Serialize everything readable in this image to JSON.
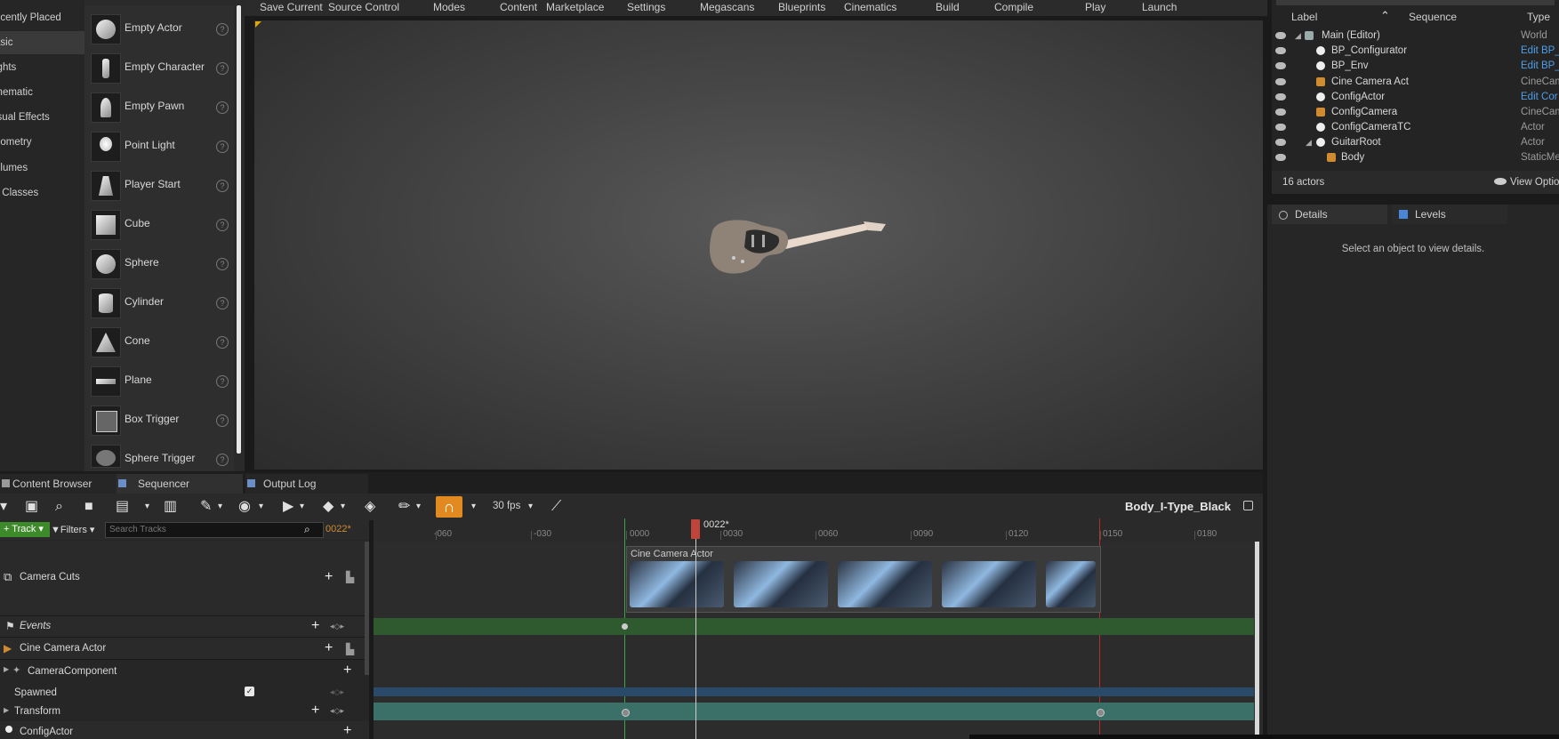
{
  "toolbar": {
    "items": [
      "Save Current",
      "Source Control",
      "Modes",
      "Content",
      "Marketplace",
      "Settings",
      "Megascans",
      "Blueprints",
      "Cinematics",
      "Build",
      "Compile",
      "Play",
      "Launch"
    ]
  },
  "place": {
    "categories": [
      "ecently Placed",
      "asic",
      "ights",
      "inematic",
      "isual Effects",
      "eometry",
      "olumes",
      "ll Classes"
    ],
    "items": [
      "Empty Actor",
      "Empty Character",
      "Empty Pawn",
      "Point Light",
      "Player Start",
      "Cube",
      "Sphere",
      "Cylinder",
      "Cone",
      "Plane",
      "Box Trigger",
      "Sphere Trigger"
    ]
  },
  "outliner": {
    "headers": {
      "label": "Label",
      "sequence": "Sequence",
      "type": "Type"
    },
    "rows": [
      {
        "name": "Main (Editor)",
        "type": "World",
        "link": false
      },
      {
        "name": "BP_Configurator",
        "type": "Edit BP_",
        "link": true
      },
      {
        "name": "BP_Env",
        "type": "Edit BP_",
        "link": true
      },
      {
        "name": "Cine Camera Act",
        "type": "CineCam",
        "link": false
      },
      {
        "name": "ConfigActor",
        "type": "Edit Cor",
        "link": true
      },
      {
        "name": "ConfigCamera",
        "type": "CineCam",
        "link": false
      },
      {
        "name": "ConfigCameraTC",
        "type": "Actor",
        "link": false
      },
      {
        "name": "GuitarRoot",
        "type": "Actor",
        "link": false
      },
      {
        "name": "Body",
        "type": "StaticMe",
        "link": false
      }
    ],
    "count": "16 actors",
    "view_options": "View Optio"
  },
  "details": {
    "tab1": "Details",
    "tab2": "Levels",
    "empty_message": "Select an object to view details."
  },
  "bottom_tabs": [
    "Content Browser",
    "Sequencer",
    "Output Log"
  ],
  "sequencer": {
    "fps": "30 fps",
    "sequence_name": "Body_I-Type_Black",
    "add_track": "Track",
    "filters": "Filters",
    "search_placeholder": "Search Tracks",
    "current_frame": "0022*",
    "playhead_label": "0022*",
    "ruler_labels": [
      "-060",
      "-030",
      "0000",
      "0030",
      "0060",
      "0090",
      "0120",
      "0150",
      "0180"
    ],
    "tracks": [
      "Camera Cuts",
      "Events",
      "Cine Camera Actor",
      "CameraComponent",
      "Spawned",
      "Transform",
      "ConfigActor"
    ],
    "camera_section_label": "Cine Camera Actor"
  }
}
